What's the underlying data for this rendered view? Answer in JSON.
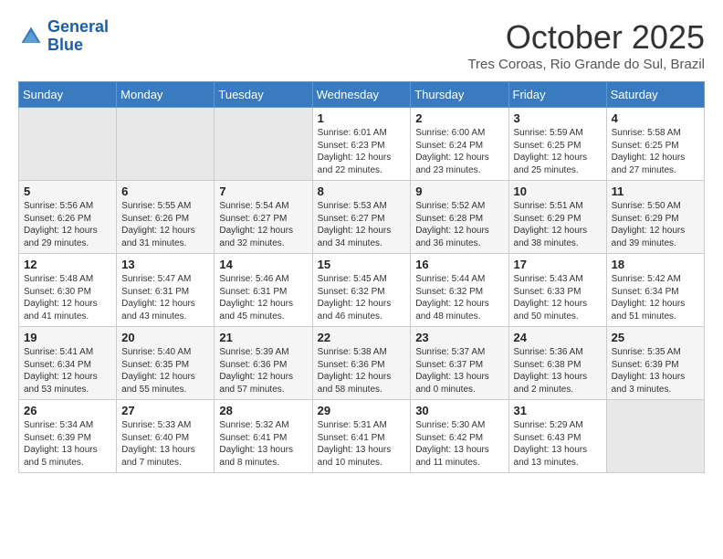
{
  "logo": {
    "line1": "General",
    "line2": "Blue"
  },
  "title": "October 2025",
  "location": "Tres Coroas, Rio Grande do Sul, Brazil",
  "weekdays": [
    "Sunday",
    "Monday",
    "Tuesday",
    "Wednesday",
    "Thursday",
    "Friday",
    "Saturday"
  ],
  "weeks": [
    [
      {
        "day": "",
        "sunrise": "",
        "sunset": "",
        "daylight": ""
      },
      {
        "day": "",
        "sunrise": "",
        "sunset": "",
        "daylight": ""
      },
      {
        "day": "",
        "sunrise": "",
        "sunset": "",
        "daylight": ""
      },
      {
        "day": "1",
        "sunrise": "Sunrise: 6:01 AM",
        "sunset": "Sunset: 6:23 PM",
        "daylight": "Daylight: 12 hours and 22 minutes."
      },
      {
        "day": "2",
        "sunrise": "Sunrise: 6:00 AM",
        "sunset": "Sunset: 6:24 PM",
        "daylight": "Daylight: 12 hours and 23 minutes."
      },
      {
        "day": "3",
        "sunrise": "Sunrise: 5:59 AM",
        "sunset": "Sunset: 6:25 PM",
        "daylight": "Daylight: 12 hours and 25 minutes."
      },
      {
        "day": "4",
        "sunrise": "Sunrise: 5:58 AM",
        "sunset": "Sunset: 6:25 PM",
        "daylight": "Daylight: 12 hours and 27 minutes."
      }
    ],
    [
      {
        "day": "5",
        "sunrise": "Sunrise: 5:56 AM",
        "sunset": "Sunset: 6:26 PM",
        "daylight": "Daylight: 12 hours and 29 minutes."
      },
      {
        "day": "6",
        "sunrise": "Sunrise: 5:55 AM",
        "sunset": "Sunset: 6:26 PM",
        "daylight": "Daylight: 12 hours and 31 minutes."
      },
      {
        "day": "7",
        "sunrise": "Sunrise: 5:54 AM",
        "sunset": "Sunset: 6:27 PM",
        "daylight": "Daylight: 12 hours and 32 minutes."
      },
      {
        "day": "8",
        "sunrise": "Sunrise: 5:53 AM",
        "sunset": "Sunset: 6:27 PM",
        "daylight": "Daylight: 12 hours and 34 minutes."
      },
      {
        "day": "9",
        "sunrise": "Sunrise: 5:52 AM",
        "sunset": "Sunset: 6:28 PM",
        "daylight": "Daylight: 12 hours and 36 minutes."
      },
      {
        "day": "10",
        "sunrise": "Sunrise: 5:51 AM",
        "sunset": "Sunset: 6:29 PM",
        "daylight": "Daylight: 12 hours and 38 minutes."
      },
      {
        "day": "11",
        "sunrise": "Sunrise: 5:50 AM",
        "sunset": "Sunset: 6:29 PM",
        "daylight": "Daylight: 12 hours and 39 minutes."
      }
    ],
    [
      {
        "day": "12",
        "sunrise": "Sunrise: 5:48 AM",
        "sunset": "Sunset: 6:30 PM",
        "daylight": "Daylight: 12 hours and 41 minutes."
      },
      {
        "day": "13",
        "sunrise": "Sunrise: 5:47 AM",
        "sunset": "Sunset: 6:31 PM",
        "daylight": "Daylight: 12 hours and 43 minutes."
      },
      {
        "day": "14",
        "sunrise": "Sunrise: 5:46 AM",
        "sunset": "Sunset: 6:31 PM",
        "daylight": "Daylight: 12 hours and 45 minutes."
      },
      {
        "day": "15",
        "sunrise": "Sunrise: 5:45 AM",
        "sunset": "Sunset: 6:32 PM",
        "daylight": "Daylight: 12 hours and 46 minutes."
      },
      {
        "day": "16",
        "sunrise": "Sunrise: 5:44 AM",
        "sunset": "Sunset: 6:32 PM",
        "daylight": "Daylight: 12 hours and 48 minutes."
      },
      {
        "day": "17",
        "sunrise": "Sunrise: 5:43 AM",
        "sunset": "Sunset: 6:33 PM",
        "daylight": "Daylight: 12 hours and 50 minutes."
      },
      {
        "day": "18",
        "sunrise": "Sunrise: 5:42 AM",
        "sunset": "Sunset: 6:34 PM",
        "daylight": "Daylight: 12 hours and 51 minutes."
      }
    ],
    [
      {
        "day": "19",
        "sunrise": "Sunrise: 5:41 AM",
        "sunset": "Sunset: 6:34 PM",
        "daylight": "Daylight: 12 hours and 53 minutes."
      },
      {
        "day": "20",
        "sunrise": "Sunrise: 5:40 AM",
        "sunset": "Sunset: 6:35 PM",
        "daylight": "Daylight: 12 hours and 55 minutes."
      },
      {
        "day": "21",
        "sunrise": "Sunrise: 5:39 AM",
        "sunset": "Sunset: 6:36 PM",
        "daylight": "Daylight: 12 hours and 57 minutes."
      },
      {
        "day": "22",
        "sunrise": "Sunrise: 5:38 AM",
        "sunset": "Sunset: 6:36 PM",
        "daylight": "Daylight: 12 hours and 58 minutes."
      },
      {
        "day": "23",
        "sunrise": "Sunrise: 5:37 AM",
        "sunset": "Sunset: 6:37 PM",
        "daylight": "Daylight: 13 hours and 0 minutes."
      },
      {
        "day": "24",
        "sunrise": "Sunrise: 5:36 AM",
        "sunset": "Sunset: 6:38 PM",
        "daylight": "Daylight: 13 hours and 2 minutes."
      },
      {
        "day": "25",
        "sunrise": "Sunrise: 5:35 AM",
        "sunset": "Sunset: 6:39 PM",
        "daylight": "Daylight: 13 hours and 3 minutes."
      }
    ],
    [
      {
        "day": "26",
        "sunrise": "Sunrise: 5:34 AM",
        "sunset": "Sunset: 6:39 PM",
        "daylight": "Daylight: 13 hours and 5 minutes."
      },
      {
        "day": "27",
        "sunrise": "Sunrise: 5:33 AM",
        "sunset": "Sunset: 6:40 PM",
        "daylight": "Daylight: 13 hours and 7 minutes."
      },
      {
        "day": "28",
        "sunrise": "Sunrise: 5:32 AM",
        "sunset": "Sunset: 6:41 PM",
        "daylight": "Daylight: 13 hours and 8 minutes."
      },
      {
        "day": "29",
        "sunrise": "Sunrise: 5:31 AM",
        "sunset": "Sunset: 6:41 PM",
        "daylight": "Daylight: 13 hours and 10 minutes."
      },
      {
        "day": "30",
        "sunrise": "Sunrise: 5:30 AM",
        "sunset": "Sunset: 6:42 PM",
        "daylight": "Daylight: 13 hours and 11 minutes."
      },
      {
        "day": "31",
        "sunrise": "Sunrise: 5:29 AM",
        "sunset": "Sunset: 6:43 PM",
        "daylight": "Daylight: 13 hours and 13 minutes."
      },
      {
        "day": "",
        "sunrise": "",
        "sunset": "",
        "daylight": ""
      }
    ]
  ]
}
